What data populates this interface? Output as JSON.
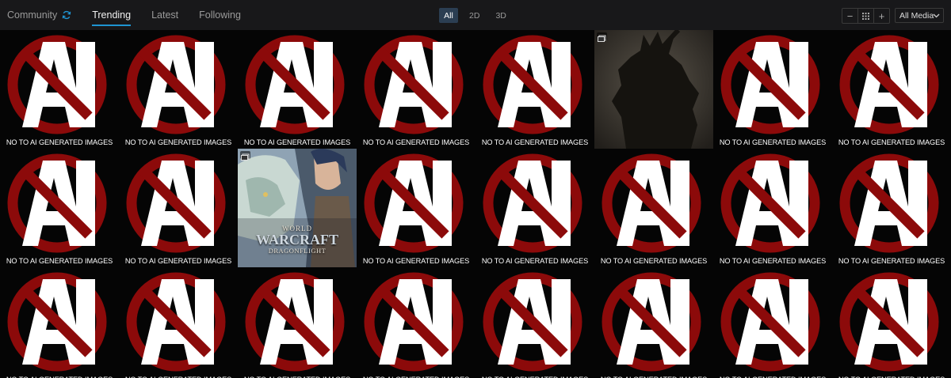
{
  "nav": {
    "items": [
      {
        "label": "Community",
        "active": false
      },
      {
        "label": "Trending",
        "active": true
      },
      {
        "label": "Latest",
        "active": false
      },
      {
        "label": "Following",
        "active": false
      }
    ]
  },
  "filters": [
    "All",
    "2D",
    "3D"
  ],
  "active_filter": "All",
  "zoom": {
    "minus": "−",
    "plus": "+"
  },
  "media_select": {
    "value": "All Media"
  },
  "tiles": {
    "caption": "NO TO AI GENERATED IMAGES",
    "art_tiles": [
      {
        "row": 0,
        "col": 5,
        "kind": "dark-creature-art"
      },
      {
        "row": 1,
        "col": 2,
        "kind": "world-of-warcraft-art",
        "logo_lines": [
          "WORLD",
          "WARCRAFT",
          "DRAGONFLIGHT"
        ]
      }
    ]
  },
  "colors": {
    "accent": "#1f94d2",
    "ban_red": "#8c0a0a",
    "active_filter_bg": "#2b3e52"
  },
  "icons": [
    "refresh-icon",
    "chevron-down-icon",
    "grid-icon",
    "gallery-icon"
  ]
}
